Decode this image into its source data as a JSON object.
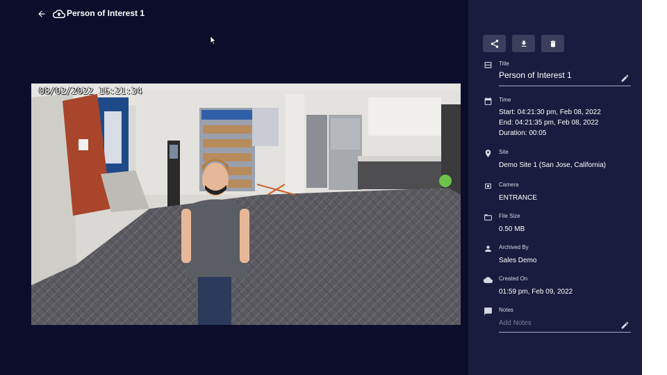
{
  "header": {
    "title": "Person of Interest 1",
    "back_icon": "arrow-left-icon",
    "cloud_icon": "cloud-upload-icon"
  },
  "video": {
    "timestamp": "08/02/2022 16:21:34"
  },
  "actions": [
    {
      "icon": "share-icon"
    },
    {
      "icon": "download-icon"
    },
    {
      "icon": "trash-icon"
    }
  ],
  "details": {
    "title_label": "Title",
    "title_value": "Person of Interest 1",
    "time_label": "Time",
    "time_start": "Start: 04:21:30 pm, Feb 08, 2022",
    "time_end": "End: 04:21:35 pm, Feb 08, 2022",
    "time_duration": "Duration: 00:05",
    "site_label": "Site",
    "site_value": "Demo Site 1 (San Jose, California)",
    "camera_label": "Camera",
    "camera_value": "ENTRANCE",
    "filesize_label": "File Size",
    "filesize_value": "0.50 MB",
    "archived_label": "Archived By",
    "archived_value": "Sales Demo",
    "created_label": "Created On",
    "created_value": "01:59 pm, Feb 09, 2022",
    "notes_label": "Notes",
    "notes_placeholder": "Add Notes"
  },
  "colors": {
    "background": "#0b0d2a",
    "panel": "#1a1c3f",
    "button": "#3c3e5e"
  }
}
